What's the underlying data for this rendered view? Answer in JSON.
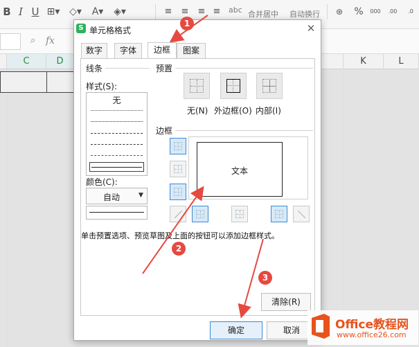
{
  "toolbar": {
    "merge_label": "合并居中",
    "wrap_label": "自动换行",
    "font_btn_label": "abc"
  },
  "formula_bar": {
    "fx_label": "fx"
  },
  "columns": [
    "C",
    "D",
    "K",
    "L"
  ],
  "dialog": {
    "title": "单元格格式",
    "app_icon": "S",
    "close_glyph": "✕",
    "tabs": [
      "数字",
      "字体",
      "边框",
      "图案"
    ],
    "active_tab": "边框",
    "line_section": {
      "title": "线条",
      "style_label": "样式(S):",
      "none_label": "无",
      "color_label": "颜色(C):",
      "color_value": "自动"
    },
    "presets": {
      "title": "预置",
      "none": "无(N)",
      "outline": "外边框(O)",
      "inside": "内部(I)"
    },
    "border": {
      "title": "边框",
      "preview_text": "文本"
    },
    "hint": "单击预置选项、预览草图及上面的按钮可以添加边框样式。",
    "clear_button": "清除(R)",
    "ok_button": "确定",
    "cancel_button": "取消"
  },
  "annotations": {
    "step1": "1",
    "step2": "2",
    "step3": "3",
    "color": "#e64940"
  },
  "watermark": {
    "title": "Office教程网",
    "url": "www.office26.com"
  }
}
